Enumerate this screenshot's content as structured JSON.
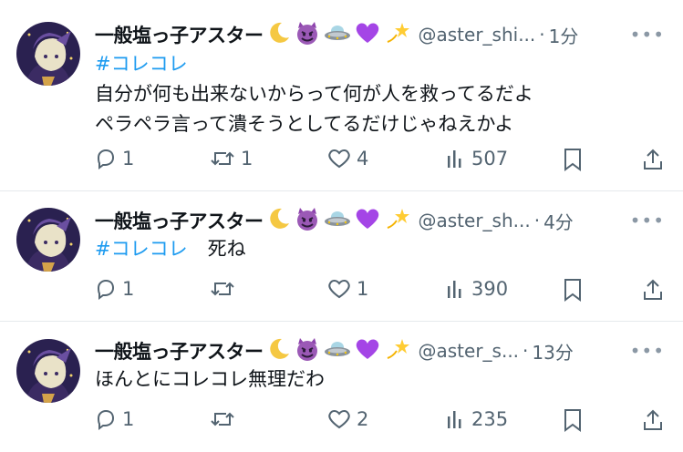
{
  "colors": {
    "accent": "#1d9bf0",
    "text": "#0f1419",
    "secondary": "#536471"
  },
  "tweets": [
    {
      "name": "一般塩っ子アスター",
      "emojis": [
        "crescent-moon-icon",
        "smiling-devil-icon",
        "flying-saucer-icon",
        "purple-heart-icon",
        "dizzy-star-icon"
      ],
      "handle": "@aster_shi...",
      "time": "1分",
      "more": "•••",
      "hashtag": "#コレコレ",
      "text_after_hashtag": "",
      "lines": [
        "自分が何も出来ないからって何が人を救ってるだよ",
        "ペラペラ言って潰そうとしてるだけじゃねえかよ"
      ],
      "replies": "1",
      "retweets": "1",
      "likes": "4",
      "views": "507"
    },
    {
      "name": "一般塩っ子アスター",
      "emojis": [
        "crescent-moon-icon",
        "smiling-devil-icon",
        "flying-saucer-icon",
        "purple-heart-icon",
        "dizzy-star-icon"
      ],
      "handle": "@aster_sh...",
      "time": "4分",
      "more": "•••",
      "hashtag": "#コレコレ",
      "text_after_hashtag": "死ね",
      "lines": [],
      "replies": "1",
      "retweets": "",
      "likes": "1",
      "views": "390"
    },
    {
      "name": "一般塩っ子アスター",
      "emojis": [
        "crescent-moon-icon",
        "smiling-devil-icon",
        "flying-saucer-icon",
        "purple-heart-icon",
        "dizzy-star-icon"
      ],
      "handle": "@aster_s...",
      "time": "13分",
      "more": "•••",
      "hashtag": "",
      "text_after_hashtag": "",
      "lines": [
        "ほんとにコレコレ無理だわ"
      ],
      "replies": "1",
      "retweets": "",
      "likes": "2",
      "views": "235"
    }
  ]
}
